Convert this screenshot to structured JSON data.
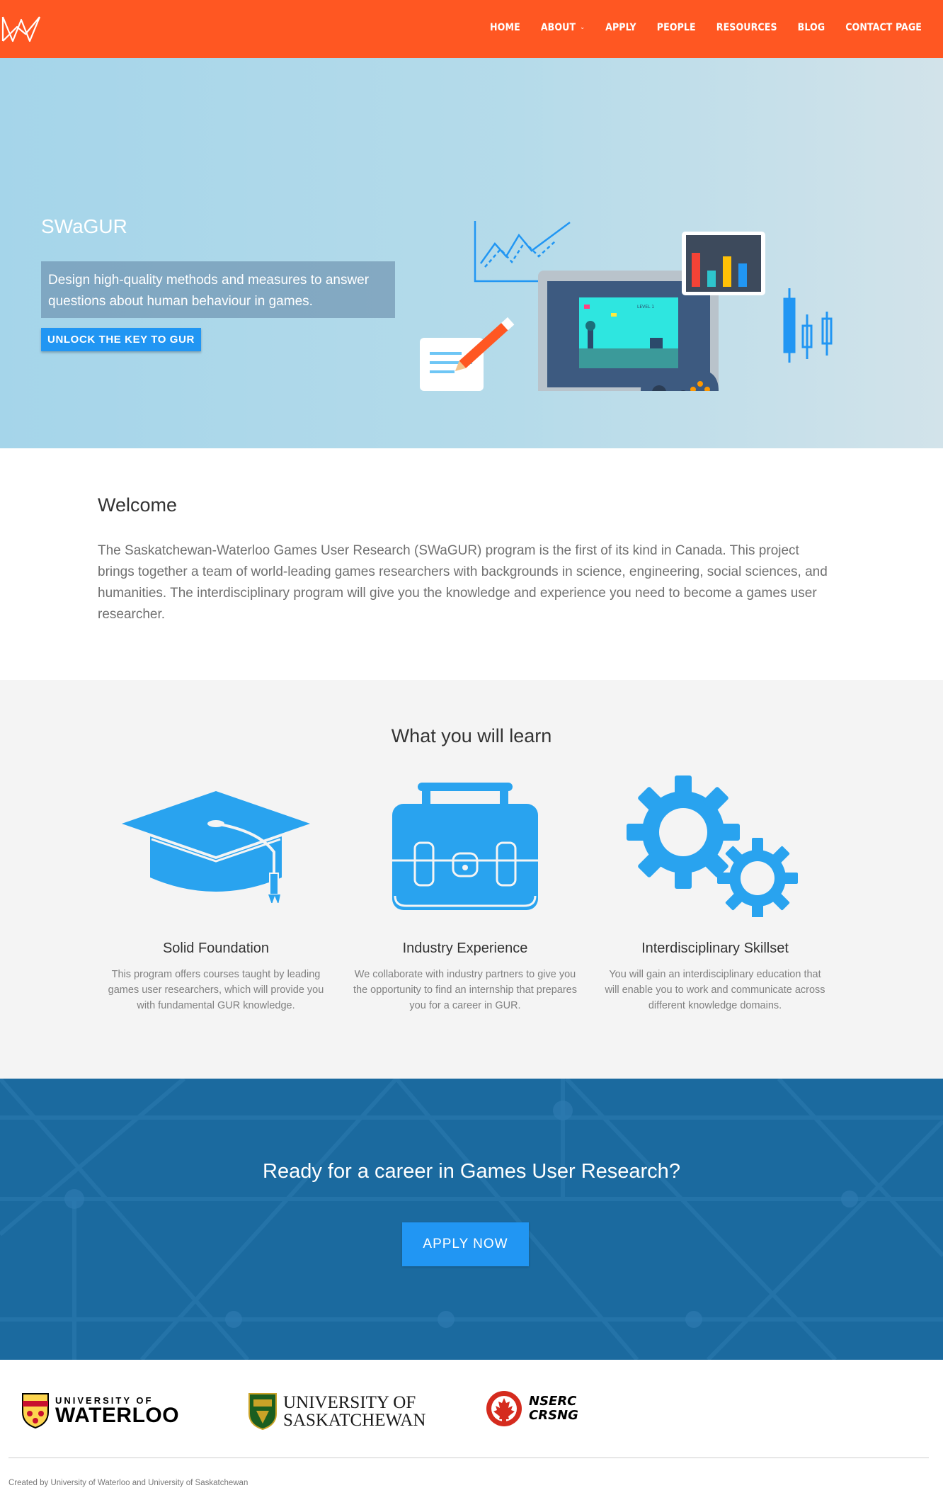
{
  "nav": {
    "logo_icon": "swagur-logo-icon",
    "items": [
      {
        "label": "HOME"
      },
      {
        "label": "ABOUT",
        "has_dropdown": true
      },
      {
        "label": "APPLY"
      },
      {
        "label": "PEOPLE"
      },
      {
        "label": "RESOURCES"
      },
      {
        "label": "BLOG"
      },
      {
        "label": "CONTACT PAGE"
      }
    ],
    "colors": {
      "bar": "#ff5722",
      "text": "#ffffff"
    }
  },
  "hero": {
    "title": "SWaGUR",
    "tagline": "Design high-quality methods and measures to answer questions about human behaviour in games.",
    "button_label": "UNLOCK THE KEY TO GUR",
    "illustration_icon": "games-research-workstation-illustration",
    "illustration_text": {
      "game_hud": "LEVEL 1"
    },
    "accent_color": "#2196f3"
  },
  "welcome": {
    "title": "Welcome",
    "body": "The Saskatchewan-Waterloo Games User Research (SWaGUR) program is the first of its kind in Canada. This project brings together a team of world-leading games researchers with backgrounds in science, engineering, social sciences, and humanities. The interdisciplinary program will give you the knowledge and experience you need to become a games user researcher."
  },
  "learn": {
    "title": "What you will learn",
    "features": [
      {
        "icon": "graduation-cap-icon",
        "title": "Solid Foundation",
        "text": "This program offers courses taught by leading games user researchers, which will provide you with fundamental GUR knowledge."
      },
      {
        "icon": "briefcase-icon",
        "title": "Industry Experience",
        "text": "We collaborate with industry partners to give you the opportunity to find an internship that prepares you for a career in GUR."
      },
      {
        "icon": "gears-icon",
        "title": "Interdisciplinary Skillset",
        "text": "You will gain an interdisciplinary education that will enable you to work and communicate across different knowledge domains."
      }
    ],
    "icon_color": "#29a3ef"
  },
  "cta": {
    "title": "Ready for a career in Games User Research?",
    "button_label": "APPLY NOW",
    "background_color": "#1b6a9f"
  },
  "footer": {
    "partners": [
      {
        "icon": "university-of-waterloo-shield-icon",
        "line1": "UNIVERSITY OF",
        "line2": "WATERLOO"
      },
      {
        "icon": "university-of-saskatchewan-shield-icon",
        "line1": "UNIVERSITY OF",
        "line2": "SASKATCHEWAN"
      },
      {
        "icon": "nserc-maple-leaf-icon",
        "line1": "NSERC",
        "line2": "CRSNG"
      }
    ],
    "credit": "Created by University of Waterloo and University of Saskatchewan"
  }
}
